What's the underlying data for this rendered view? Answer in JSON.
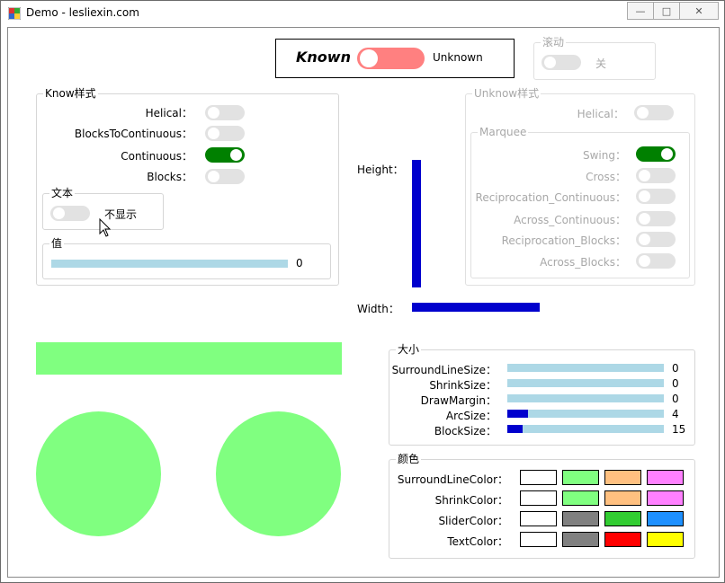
{
  "window": {
    "title": "Demo - lesliexin.com",
    "min": "—",
    "max": "□",
    "close": "✕"
  },
  "top_switch": {
    "known_label": "Known",
    "unknown_label": "Unknown",
    "on_color": "#ff8080"
  },
  "scroll": {
    "legend": "滚动",
    "state": "关"
  },
  "know_style": {
    "legend": "Know样式",
    "items": [
      {
        "label": "Helical：",
        "on": false
      },
      {
        "label": "BlocksToContinuous：",
        "on": false
      },
      {
        "label": "Continuous：",
        "on": true
      },
      {
        "label": "Blocks：",
        "on": false
      }
    ]
  },
  "text_box": {
    "legend": "文本",
    "state": "不显示"
  },
  "value_box": {
    "legend": "值",
    "value": "0",
    "fraction": 0
  },
  "unknow_style": {
    "legend": "Unknow样式",
    "helical": "Helical：",
    "marquee_legend": "Marquee",
    "items": [
      {
        "label": "Swing：",
        "on": true
      },
      {
        "label": "Cross：",
        "on": false
      },
      {
        "label": "Reciprocation_Continuous：",
        "on": false
      },
      {
        "label": "Across_Continuous：",
        "on": false
      },
      {
        "label": "Reciprocation_Blocks：",
        "on": false
      },
      {
        "label": "Across_Blocks：",
        "on": false
      }
    ]
  },
  "sliders": {
    "height_label": "Height：",
    "width_label": "Width：",
    "color": "#0000cd"
  },
  "size": {
    "legend": "大小",
    "items": [
      {
        "label": "SurroundLineSize：",
        "value": "0",
        "fraction": 0
      },
      {
        "label": "ShrinkSize：",
        "value": "0",
        "fraction": 0
      },
      {
        "label": "DrawMargin：",
        "value": "0",
        "fraction": 0
      },
      {
        "label": "ArcSize：",
        "value": "4",
        "fraction": 0.13
      },
      {
        "label": "BlockSize：",
        "value": "15",
        "fraction": 0.1
      }
    ]
  },
  "colors": {
    "legend": "颜色",
    "rows": [
      {
        "label": "SurroundLineColor：",
        "swatches": [
          "#ffffff",
          "#80ff80",
          "#ffc080",
          "#ff80ff"
        ]
      },
      {
        "label": "ShrinkColor：",
        "swatches": [
          "#ffffff",
          "#80ff80",
          "#ffc080",
          "#ff80ff"
        ]
      },
      {
        "label": "SliderColor：",
        "swatches": [
          "#ffffff",
          "#808080",
          "#32cd32",
          "#1e90ff"
        ]
      },
      {
        "label": "TextColor：",
        "swatches": [
          "#ffffff",
          "#808080",
          "#ff0000",
          "#ffff00"
        ]
      }
    ]
  },
  "preview": {
    "color": "#80ff80"
  }
}
